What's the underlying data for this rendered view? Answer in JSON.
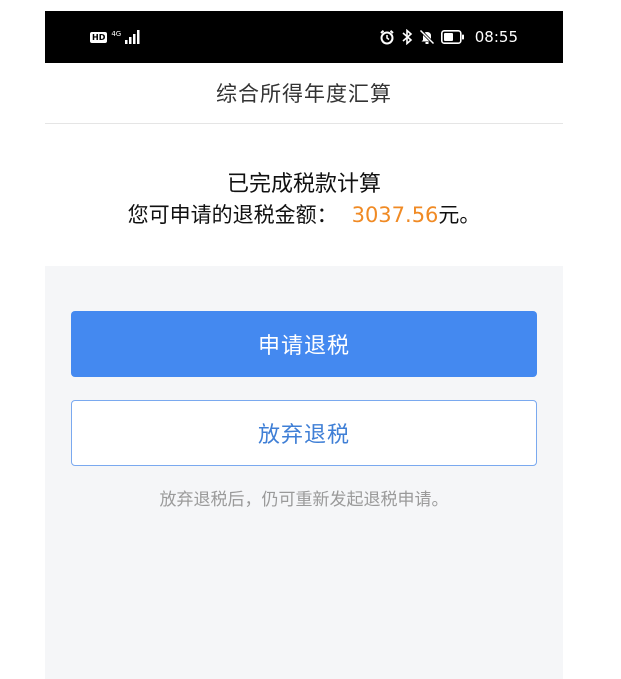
{
  "status_bar": {
    "hd_badge": "HD",
    "network_type": "4G",
    "time": "08:55",
    "icons": [
      "hd-icon",
      "signal-icon",
      "alarm-icon",
      "bluetooth-icon",
      "mute-icon",
      "battery-icon"
    ],
    "colors": {
      "background": "#000000",
      "foreground": "#ffffff"
    }
  },
  "header": {
    "title": "综合所得年度汇算"
  },
  "result": {
    "title": "已完成税款计算",
    "amount_label": "您可申请的退税金额：",
    "amount_value": "3037.56",
    "amount_unit": "元。",
    "colors": {
      "amount": "#f08a24"
    }
  },
  "actions": {
    "apply_label": "申请退税",
    "giveup_label": "放弃退税",
    "hint": "放弃退税后，仍可重新发起退税申请。",
    "colors": {
      "primary": "#4489f0",
      "outline_text": "#3f7fd6",
      "hint": "#9a9a9a",
      "background": "#f5f6f8"
    }
  }
}
